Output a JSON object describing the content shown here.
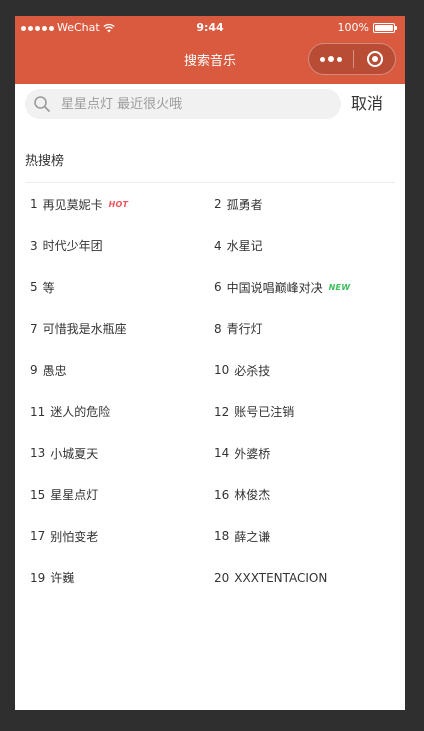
{
  "status_bar": {
    "carrier": "WeChat",
    "time": "9:44",
    "battery": "100%"
  },
  "nav": {
    "title": "搜索音乐"
  },
  "search": {
    "placeholder": "星星点灯 最近很火哦",
    "value": "",
    "cancel_label": "取消"
  },
  "section": {
    "title": "热搜榜"
  },
  "colors": {
    "header": "#da5a3f",
    "hot_tag": "#e8565a",
    "new_tag": "#3bbf5a"
  },
  "hot_items": [
    {
      "rank": "1",
      "title": "再见莫妮卡",
      "tag": "HOT"
    },
    {
      "rank": "2",
      "title": "孤勇者",
      "tag": ""
    },
    {
      "rank": "3",
      "title": "时代少年团",
      "tag": ""
    },
    {
      "rank": "4",
      "title": "水星记",
      "tag": ""
    },
    {
      "rank": "5",
      "title": "等",
      "tag": ""
    },
    {
      "rank": "6",
      "title": "中国说唱巅峰对决",
      "tag": "NEW"
    },
    {
      "rank": "7",
      "title": "可惜我是水瓶座",
      "tag": ""
    },
    {
      "rank": "8",
      "title": "青行灯",
      "tag": ""
    },
    {
      "rank": "9",
      "title": "愚忠",
      "tag": ""
    },
    {
      "rank": "10",
      "title": "必杀技",
      "tag": ""
    },
    {
      "rank": "11",
      "title": "迷人的危险",
      "tag": ""
    },
    {
      "rank": "12",
      "title": "账号已注销",
      "tag": ""
    },
    {
      "rank": "13",
      "title": "小城夏天",
      "tag": ""
    },
    {
      "rank": "14",
      "title": "外婆桥",
      "tag": ""
    },
    {
      "rank": "15",
      "title": "星星点灯",
      "tag": ""
    },
    {
      "rank": "16",
      "title": "林俊杰",
      "tag": ""
    },
    {
      "rank": "17",
      "title": "别怕变老",
      "tag": ""
    },
    {
      "rank": "18",
      "title": "薛之谦",
      "tag": ""
    },
    {
      "rank": "19",
      "title": "许巍",
      "tag": ""
    },
    {
      "rank": "20",
      "title": "XXXTENTACION",
      "tag": ""
    }
  ]
}
